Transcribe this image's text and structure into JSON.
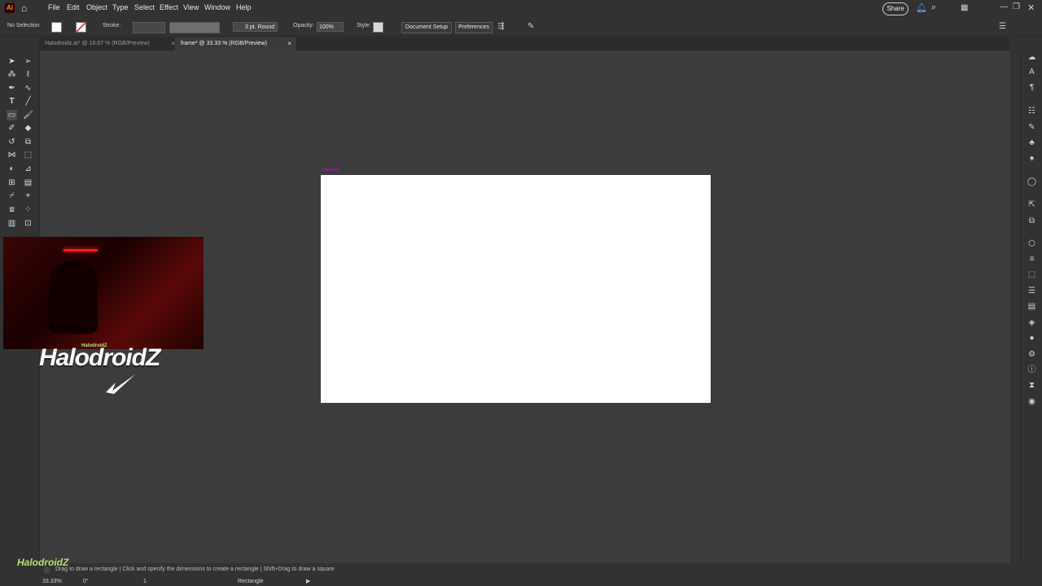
{
  "app": {
    "logo_text": "Ai"
  },
  "menu": [
    "File",
    "Edit",
    "Object",
    "Type",
    "Select",
    "Effect",
    "View",
    "Window",
    "Help"
  ],
  "header": {
    "share_label": "Share"
  },
  "control": {
    "selection": "No Selection",
    "stroke_label": "Stroke:",
    "brush": "3 pt. Round",
    "opacity_label": "Opacity:",
    "opacity_value": "100%",
    "style_label": "Style:",
    "doc_setup": "Document Setup",
    "preferences": "Preferences",
    "fill_color": "#ffffff"
  },
  "tabs": [
    {
      "label": "Halodroidz.ai* @ 16.67 % (RGB/Preview)",
      "close": "×"
    },
    {
      "label": "frame* @ 33.33 % (RGB/Preview)",
      "close": "×"
    }
  ],
  "canvas": {
    "smart_guide": "intersect",
    "artboard_color": "#ffffff"
  },
  "overlay": {
    "brand": "HalodroidZ",
    "tag": "HalodroidZ",
    "watermark": "HalodroidZ"
  },
  "status": {
    "hint": "Drag to draw a rectangle  |  Click and specify the dimensions to create a rectangle  |  Shift+Drag to draw a square",
    "zoom": "33.33%",
    "rotation": "0°",
    "page": "1",
    "tool": "Rectangle"
  },
  "colors": {
    "bg": "#323232",
    "canvas": "#3c3c3c",
    "accent_magenta": "#e000e0",
    "brand_green": "#b8e06a"
  }
}
